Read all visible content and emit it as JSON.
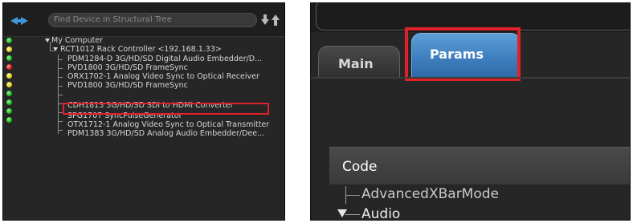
{
  "left": {
    "search": {
      "placeholder": "Find Device in Structural Tree"
    },
    "tree": {
      "root_label": "My Computer",
      "controller_label": "RCT1012 Rack Controller <192.168.1.33>",
      "devices": [
        {
          "label": "PDM1284-D 3G/HD/SD Digital Audio Embedder/D...",
          "status": "green"
        },
        {
          "label": "PVD1800 3G/HD/SD FrameSync",
          "status": "red"
        },
        {
          "label": "ORX1702-1 Analog Video Sync to Optical Receiver",
          "status": "yellow"
        },
        {
          "label": "PVD1800 3G/HD/SD FrameSync",
          "status": "yellow"
        },
        {
          "label": "CDH1813 3G/HD/SD SDI to HDMI Converter",
          "status": "green"
        },
        {
          "label": "SPG1707 SyncPulseGenerator",
          "status": "green"
        },
        {
          "label": "OTX1712-1 Analog Video Sync to Optical Transmitter",
          "status": "green"
        },
        {
          "label": "PDM1383 3G/HD/SD Analog Audio Embedder/Dee...",
          "status": "green"
        }
      ],
      "root_status": "green",
      "controller_status": "yellow"
    }
  },
  "right": {
    "tabs": [
      {
        "label": "Main",
        "selected": false
      },
      {
        "label": "Params",
        "selected": true
      }
    ],
    "table": {
      "header": "Code",
      "rows": [
        {
          "label": "AdvancedXBarMode"
        },
        {
          "label": "Audio"
        }
      ]
    }
  },
  "colors": {
    "highlight": "#e0202a",
    "selected_tab": "#3f7fbf",
    "panel_background": "#262626"
  }
}
